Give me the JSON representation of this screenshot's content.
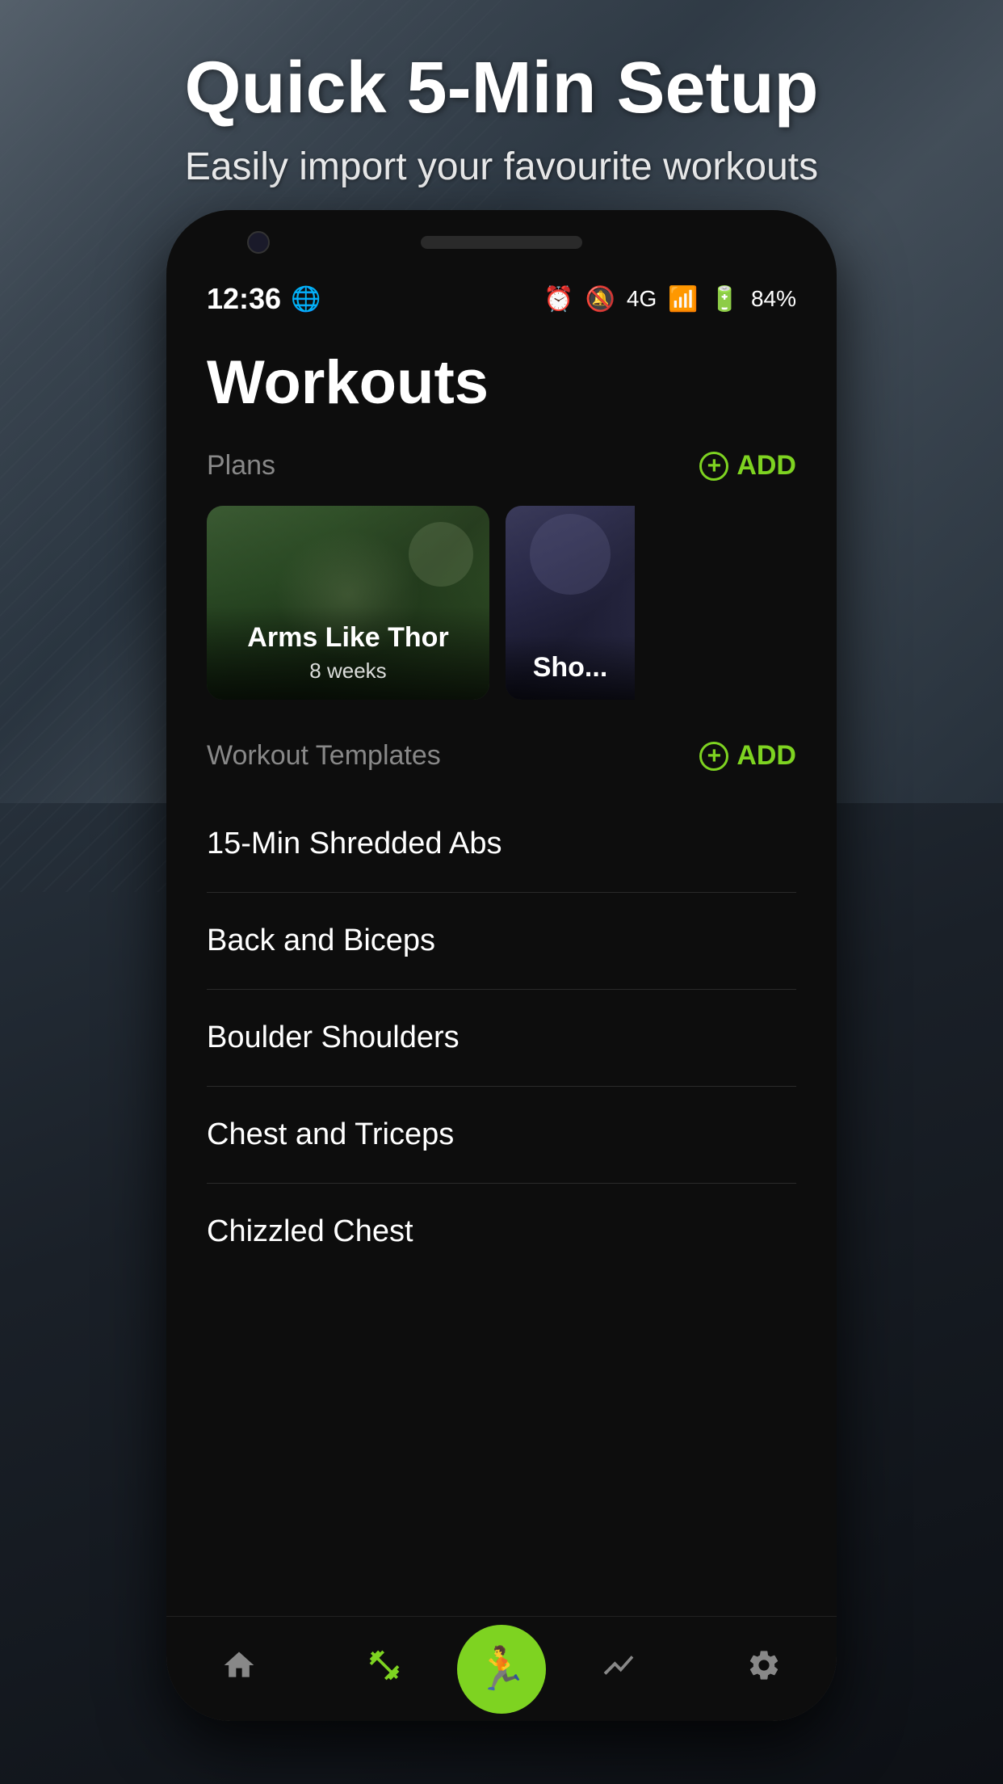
{
  "marketing": {
    "title": "Quick 5-Min Setup",
    "subtitle": "Easily import your favourite workouts"
  },
  "status_bar": {
    "time": "12:36",
    "world_icon": "🌐",
    "battery_percent": "84%",
    "signal": "4G",
    "icons": "⏰ 🔕 4G 📶 🔋 84%"
  },
  "page": {
    "title": "Workouts"
  },
  "plans_section": {
    "label": "Plans",
    "add_label": "ADD"
  },
  "plans": [
    {
      "title": "Arms Like Thor",
      "subtitle": "8 weeks"
    },
    {
      "title": "Sho...",
      "subtitle": ""
    }
  ],
  "templates_section": {
    "label": "Workout Templates",
    "add_label": "ADD"
  },
  "templates": [
    {
      "name": "15-Min Shredded Abs"
    },
    {
      "name": "Back and Biceps"
    },
    {
      "name": "Boulder Shoulders"
    },
    {
      "name": "Chest and Triceps"
    },
    {
      "name": "Chizzled Chest"
    }
  ],
  "bottom_nav": {
    "items": [
      {
        "icon": "home",
        "label": "Home"
      },
      {
        "icon": "dumbbell",
        "label": "Workouts"
      },
      {
        "icon": "run",
        "label": "Active",
        "active": true
      },
      {
        "icon": "chart",
        "label": "Progress"
      },
      {
        "icon": "settings",
        "label": "Settings"
      }
    ]
  },
  "colors": {
    "accent": "#7ed321",
    "background": "#0d0d0d",
    "text_primary": "#ffffff",
    "text_secondary": "#888888"
  }
}
